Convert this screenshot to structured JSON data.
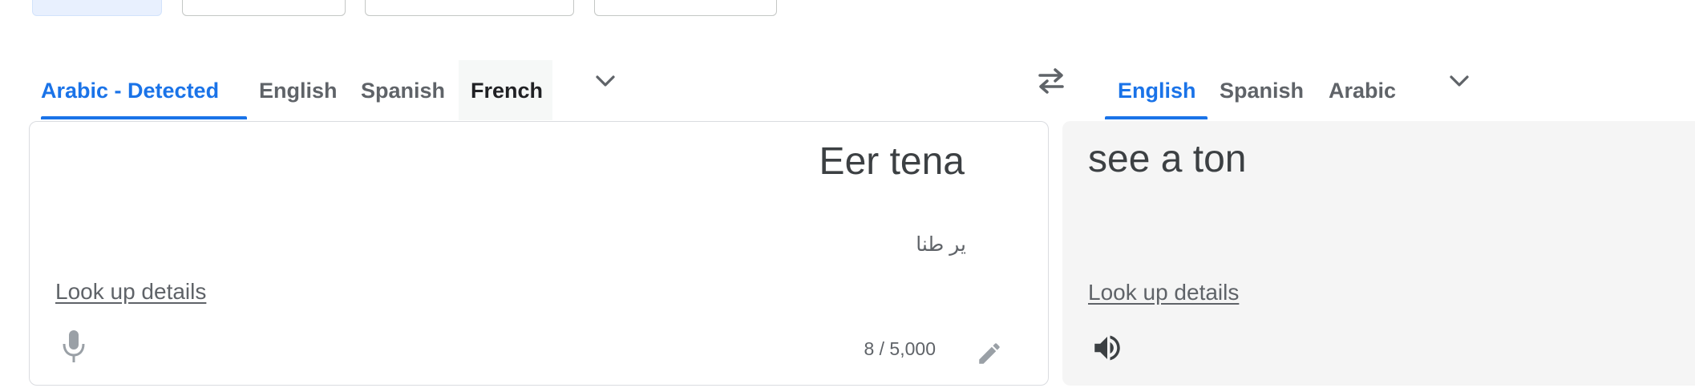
{
  "mode_bar": {
    "buttons": [
      {
        "name": "text-mode-button",
        "active": true
      },
      {
        "name": "images-mode-button",
        "active": false
      },
      {
        "name": "documents-mode-button",
        "active": false
      },
      {
        "name": "websites-mode-button",
        "active": false
      }
    ]
  },
  "source_langs": {
    "tabs": [
      "Arabic - Detected",
      "English",
      "Spanish",
      "French"
    ],
    "active_index": 0,
    "hovered_index": 3
  },
  "target_langs": {
    "tabs": [
      "English",
      "Spanish",
      "Arabic"
    ],
    "active_index": 0
  },
  "source": {
    "text": "Eer tena",
    "transliteration": "ير طنا",
    "lookup_label": "Look up details",
    "char_count": "8 / 5,000"
  },
  "target": {
    "text": "see a ton",
    "lookup_label": "Look up details"
  },
  "colors": {
    "accent": "#1a73e8",
    "target_bg": "#f5f5f5"
  },
  "icons": {
    "more_source_langs": "chevron-down-icon",
    "swap": "swap-languages-icon",
    "more_target_langs": "chevron-down-icon",
    "mic": "microphone-icon",
    "edit": "pencil-icon",
    "listen": "speaker-icon"
  }
}
